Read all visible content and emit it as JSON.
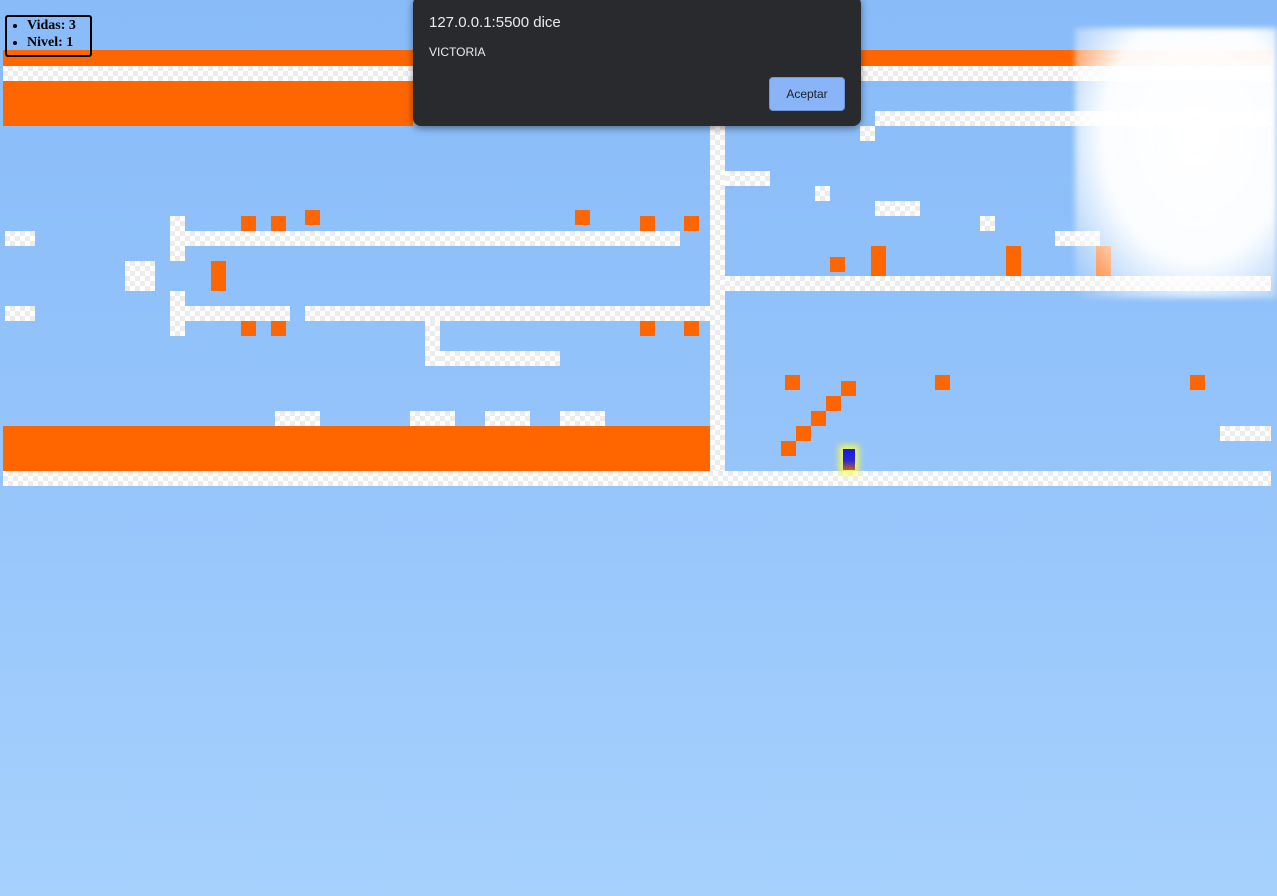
{
  "hud": {
    "lives": "Vidas: 3",
    "level": "Nivel: 1"
  },
  "dialog": {
    "title": "127.0.0.1:5500 dice",
    "message": "VICTORIA",
    "ok_label": "Aceptar"
  },
  "colors": {
    "sky": "#88bbf8",
    "lava": "#ff6600",
    "wall": "#ffffff",
    "player": "#1616e6",
    "dialog_bg": "#292a2d",
    "dialog_button": "#8ab4f8"
  }
}
